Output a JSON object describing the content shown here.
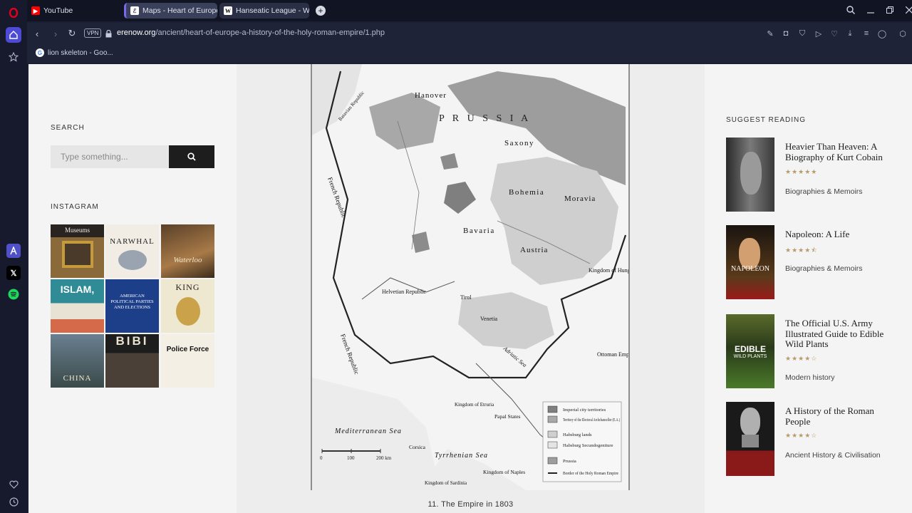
{
  "browser": {
    "tabs": [
      {
        "label": "YouTube"
      },
      {
        "label": "Maps - Heart of Europe: A"
      },
      {
        "label": "Hanseatic League - Wikipe"
      }
    ],
    "url_domain": "erenow.org",
    "url_path": "/ancient/heart-of-europe-a-history-of-the-holy-roman-empire/1.php",
    "vpn_label": "VPN",
    "bookmark": "lion skeleton - Goo..."
  },
  "sidebar_left": {
    "search_heading": "SEARCH",
    "search_placeholder": "Type something...",
    "instagram_heading": "INSTAGRAM",
    "instagram_tiles": [
      {
        "text": "Museums"
      },
      {
        "text": "NARWHAL"
      },
      {
        "text": "Waterloo"
      },
      {
        "text": "ISLAM,"
      },
      {
        "text": "AMERICAN POLITICAL PARTIES AND ELECTIONS"
      },
      {
        "text": "KING"
      },
      {
        "text": "CHINA"
      },
      {
        "text": "BIBI"
      },
      {
        "text": "Police Force"
      }
    ]
  },
  "figure": {
    "caption": "11. The Empire in 1803",
    "map_labels": {
      "hanover": "Hanover",
      "saxony": "Saxony",
      "bohemia": "Bohemia",
      "moravia": "Moravia",
      "bavaria": "Bavaria",
      "austria": "Austria",
      "tirol": "Tirol",
      "venetia": "Venetia",
      "hungary": "Kingdom of Hungary",
      "ottoman": "Ottoman Empire",
      "french_republic": "French Republic",
      "batavian": "Batavian Republic",
      "helvetian": "Helvetian Republic",
      "mediterranean": "Mediterranean Sea",
      "tyrrhenian": "Tyrrhenian Sea",
      "adriatic": "Adriatic Sea",
      "naples": "Kingdom of Naples",
      "papal": "Papal States",
      "prussia": "P R U S S I A",
      "sardinia": "Kingdom of Sardinia",
      "corsica": "Corsica",
      "etruria": "Kingdom of Etruria",
      "scale_0": "0",
      "scale_100": "100",
      "scale_200": "200 km"
    },
    "legend": [
      "Imperial city territories",
      "Territory of the Electoral Archchancellor (E.A.)",
      "Habsburg lands",
      "Habsburg Secundogeniture",
      "Prussia",
      "Border of the Holy Roman Empire"
    ]
  },
  "sidebar_right": {
    "heading": "SUGGEST READING",
    "books": [
      {
        "title": "Heavier Than Heaven: A Biography of Kurt Cobain",
        "rating": 5,
        "category": "Biographies & Memoirs"
      },
      {
        "title": "Napoleon: A Life",
        "rating": 4.5,
        "category": "Biographies & Memoirs"
      },
      {
        "title": "The Official U.S. Army Illustrated Guide to Edible Wild Plants",
        "rating": 4,
        "category": "Modern history"
      },
      {
        "title": "A History of the Roman People",
        "rating": 4,
        "category": "Ancient History & Civilisation"
      }
    ]
  },
  "colors": {
    "accent": "#7b68ee",
    "star": "#b79a6b",
    "search_button": "#1d1d1d"
  }
}
